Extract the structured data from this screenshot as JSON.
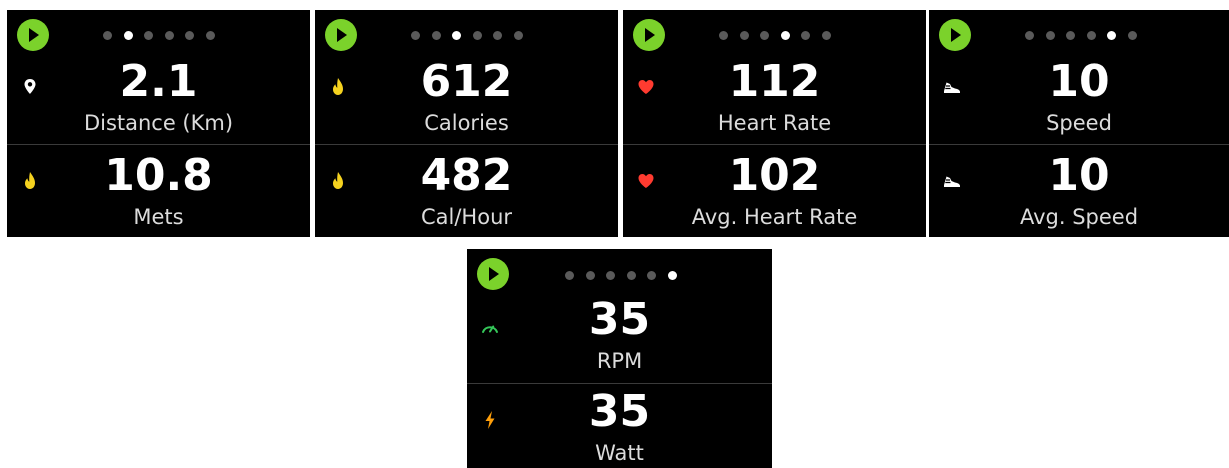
{
  "screens": [
    {
      "active_dot": 1,
      "metrics": [
        {
          "value": "2.1",
          "label": "Distance (Km)",
          "icon": "location-pin-icon",
          "icon_color": "#ffffff"
        },
        {
          "value": "10.8",
          "label": "Mets",
          "icon": "flame-icon",
          "icon_color": "#f5d21f"
        }
      ]
    },
    {
      "active_dot": 2,
      "metrics": [
        {
          "value": "612",
          "label": "Calories",
          "icon": "flame-icon",
          "icon_color": "#f5d21f"
        },
        {
          "value": "482",
          "label": "Cal/Hour",
          "icon": "flame-icon",
          "icon_color": "#f5d21f"
        }
      ]
    },
    {
      "active_dot": 3,
      "metrics": [
        {
          "value": "112",
          "label": "Heart Rate",
          "icon": "heart-icon",
          "icon_color": "#ff3b30"
        },
        {
          "value": "102",
          "label": "Avg. Heart Rate",
          "icon": "heart-icon",
          "icon_color": "#ff3b30"
        }
      ]
    },
    {
      "active_dot": 4,
      "metrics": [
        {
          "value": "10",
          "label": "Speed",
          "icon": "running-shoe-icon",
          "icon_color": "#ffffff"
        },
        {
          "value": "10",
          "label": "Avg. Speed",
          "icon": "running-shoe-icon",
          "icon_color": "#ffffff"
        }
      ]
    },
    {
      "active_dot": 5,
      "metrics": [
        {
          "value": "35",
          "label": "RPM",
          "icon": "speedometer-icon",
          "icon_color": "#34c759"
        },
        {
          "value": "35",
          "label": "Watt",
          "icon": "lightning-bolt-icon",
          "icon_color": "#ff9f0a"
        }
      ]
    }
  ],
  "dot_count": 6,
  "colors": {
    "play_button": "#7bd22b",
    "dot_inactive": "#5a5a5a",
    "dot_active": "#ffffff",
    "background": "#000000"
  }
}
